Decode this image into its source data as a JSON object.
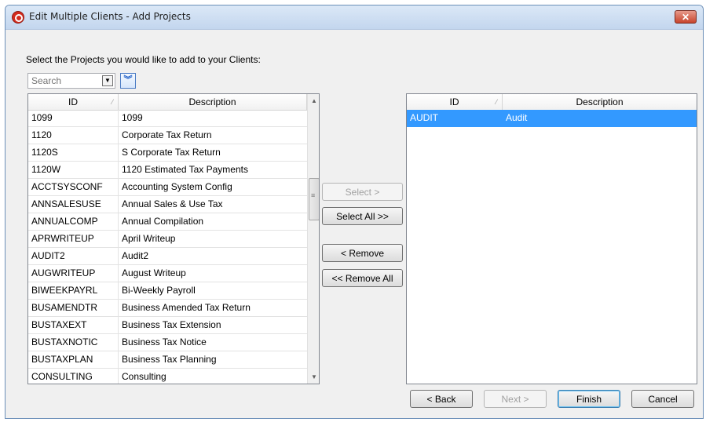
{
  "window": {
    "title": "Edit Multiple Clients - Add Projects",
    "close_label": "✕"
  },
  "instruction": "Select the Projects you would like to add to your Clients:",
  "search": {
    "placeholder": "Search"
  },
  "left_grid": {
    "columns": [
      "ID",
      "Description"
    ],
    "rows": [
      {
        "id": "1099",
        "desc": "1099"
      },
      {
        "id": "1120",
        "desc": "Corporate Tax Return"
      },
      {
        "id": "1120S",
        "desc": "S Corporate Tax Return"
      },
      {
        "id": "1120W",
        "desc": "1120 Estimated Tax Payments"
      },
      {
        "id": "ACCTSYSCONF",
        "desc": "Accounting System Config"
      },
      {
        "id": "ANNSALESUSE",
        "desc": "Annual Sales & Use Tax"
      },
      {
        "id": "ANNUALCOMP",
        "desc": "Annual Compilation"
      },
      {
        "id": "APRWRITEUP",
        "desc": "April Writeup"
      },
      {
        "id": "AUDIT2",
        "desc": "Audit2"
      },
      {
        "id": "AUGWRITEUP",
        "desc": "August Writeup"
      },
      {
        "id": "BIWEEKPAYRL",
        "desc": "Bi-Weekly Payroll"
      },
      {
        "id": "BUSAMENDTR",
        "desc": "Business Amended Tax Return"
      },
      {
        "id": "BUSTAXEXT",
        "desc": "Business Tax Extension"
      },
      {
        "id": "BUSTAXNOTIC",
        "desc": "Business Tax Notice"
      },
      {
        "id": "BUSTAXPLAN",
        "desc": "Business Tax Planning"
      },
      {
        "id": "CONSULTING",
        "desc": "Consulting"
      }
    ]
  },
  "right_grid": {
    "columns": [
      "ID",
      "Description"
    ],
    "rows": [
      {
        "id": "AUDIT",
        "desc": "Audit"
      }
    ]
  },
  "transfer_buttons": {
    "select": "Select >",
    "select_all": "Select All >>",
    "remove": "< Remove",
    "remove_all": "<< Remove All"
  },
  "footer_buttons": {
    "back": "< Back",
    "next": "Next >",
    "finish": "Finish",
    "cancel": "Cancel"
  },
  "colors": {
    "selection": "#3399ff",
    "titlebar": "#c3d6ee",
    "close": "#c8452d"
  }
}
